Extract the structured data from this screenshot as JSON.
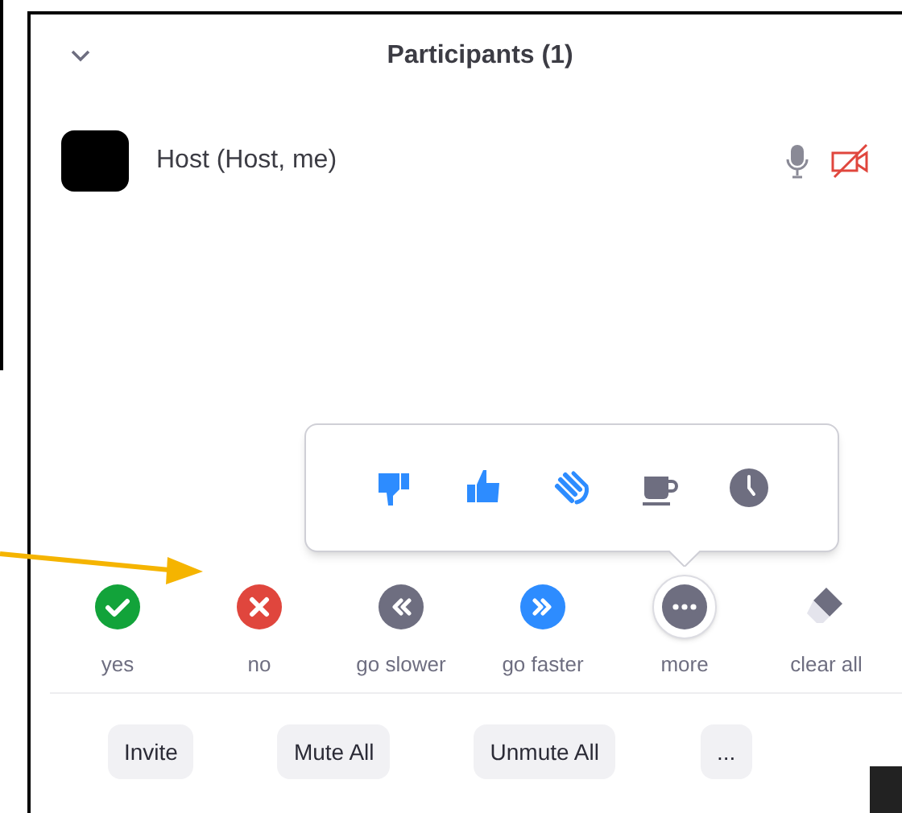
{
  "panel": {
    "title": "Participants (1)"
  },
  "participants": [
    {
      "name": "Host (Host, me)",
      "mic_muted": false,
      "video_on": false
    }
  ],
  "popup": {
    "open": true,
    "reactions": [
      {
        "kind": "thumbs-down"
      },
      {
        "kind": "thumbs-up"
      },
      {
        "kind": "clap"
      },
      {
        "kind": "coffee"
      },
      {
        "kind": "clock"
      }
    ]
  },
  "feedback": [
    {
      "kind": "yes",
      "label": "yes",
      "selected": false
    },
    {
      "kind": "no",
      "label": "no",
      "selected": false
    },
    {
      "kind": "slower",
      "label": "go slower",
      "selected": false
    },
    {
      "kind": "faster",
      "label": "go faster",
      "selected": false
    },
    {
      "kind": "more",
      "label": "more",
      "selected": true
    },
    {
      "kind": "clear",
      "label": "clear all",
      "selected": false
    }
  ],
  "buttons": [
    "Invite",
    "Mute All",
    "Unmute All",
    "..."
  ]
}
